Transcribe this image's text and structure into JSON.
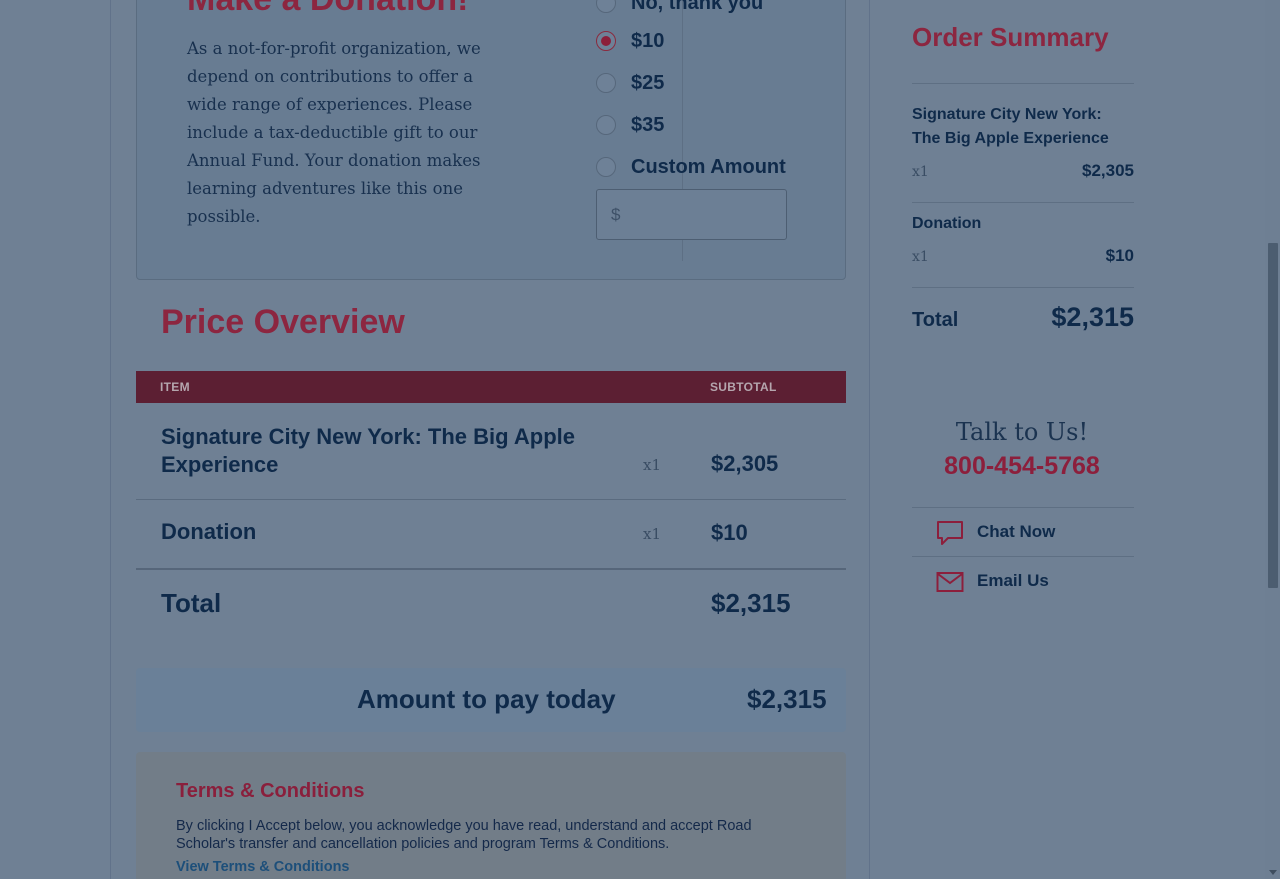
{
  "donation": {
    "title": "Make a Donation!",
    "description": "As a not-for-profit organization, we depend on contributions to offer a wide range of experiences. Please include a tax-deductible gift to our Annual Fund. Your donation makes learning adventures like this one possible.",
    "options": [
      {
        "label": "No, thank you",
        "selected": false
      },
      {
        "label": "$10",
        "selected": true
      },
      {
        "label": "$25",
        "selected": false
      },
      {
        "label": "$35",
        "selected": false
      },
      {
        "label": "Custom Amount",
        "selected": false
      }
    ],
    "custom_input_placeholder": "$",
    "custom_input_value": ""
  },
  "price_overview": {
    "title": "Price Overview",
    "header_item": "ITEM",
    "header_subtotal": "SUBTOTAL",
    "rows": [
      {
        "item": "Signature City New York: The Big Apple Experience",
        "qty": "x1",
        "subtotal": "$2,305"
      },
      {
        "item": "Donation",
        "qty": "x1",
        "subtotal": "$10"
      }
    ],
    "total_label": "Total",
    "total_value": "$2,315"
  },
  "pay_today": {
    "label": "Amount to pay today",
    "value": "$2,315"
  },
  "terms": {
    "title": "Terms & Conditions",
    "text": "By clicking I Accept below, you acknowledge you have read, understand and accept Road Scholar's transfer and cancellation policies and program Terms & Conditions.",
    "link": "View Terms & Conditions"
  },
  "order_summary": {
    "title": "Order Summary",
    "items": [
      {
        "name": "Signature City New York: The Big Apple Experience",
        "qty": "x1",
        "price": "$2,305"
      },
      {
        "name": "Donation",
        "qty": "x1",
        "price": "$10"
      }
    ],
    "total_label": "Total",
    "total_value": "$2,315"
  },
  "contact": {
    "title": "Talk to Us!",
    "phone": "800-454-5768",
    "chat_label": "Chat Now",
    "email_label": "Email Us"
  },
  "icons": {
    "chat": "chat-bubble-icon",
    "email": "envelope-icon"
  },
  "colors": {
    "accent": "#8c2640",
    "text": "#0f2a4a",
    "overlay": "#6f8094"
  }
}
